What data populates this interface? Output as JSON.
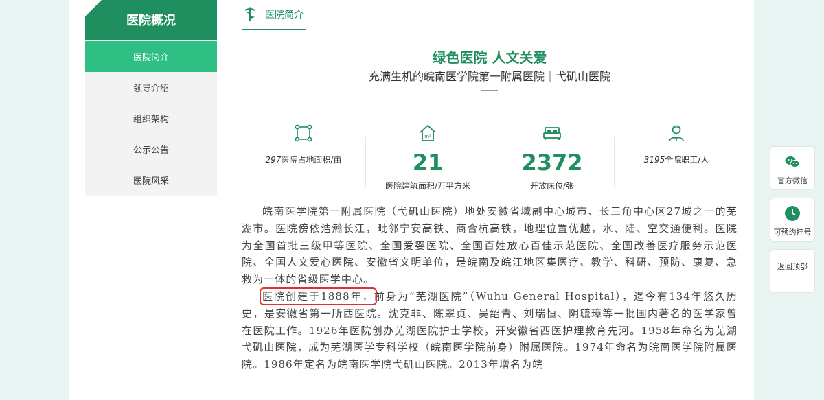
{
  "sidebar": {
    "title": "医院概况",
    "items": [
      {
        "label": "医院简介",
        "active": true
      },
      {
        "label": "领导介绍"
      },
      {
        "label": "组织架构"
      },
      {
        "label": "公示公告"
      },
      {
        "label": "医院风采"
      }
    ]
  },
  "section": {
    "title": "医院简介",
    "icon": "caduceus-icon"
  },
  "headline": {
    "title": "绿色医院 人文关爱",
    "subtitle": "充满生机的皖南医学院第一附属医院｜弋矶山医院"
  },
  "stats": [
    {
      "icon": "area-icon",
      "number": "297",
      "unit_label": "医院占地面积/亩"
    },
    {
      "icon": "building-icon",
      "number": "21",
      "unit_label": "医院建筑面积/万平方米"
    },
    {
      "icon": "bed-icon",
      "number": "2372",
      "unit_label": "开放床位/张"
    },
    {
      "icon": "doctor-icon",
      "number": "3195",
      "unit_label": "全院职工/人"
    }
  ],
  "body": {
    "p1": "皖南医学院第一附属医院（弋矶山医院）地处安徽省域副中心城市、长三角中心区27城之一的芜湖市。医院傍依浩瀚长江，毗邻宁安高铁、商合杭高铁，地理位置优越，水、陆、空交通便利。医院为全国首批三级甲等医院、全国爱婴医院、全国百姓放心百佳示范医院、全国改善医疗服务示范医院、全国人文爱心医院、安徽省文明单位，是皖南及皖江地区集医疗、教学、科研、预防、康复、急救为一体的省级医学中心。",
    "p2_highlight": "医院创建于1888年，",
    "p2_rest": "前身为“芜湖医院”（Wuhu General Hospital），迄今有134年悠久历史，是安徽省第一所西医院。沈克非、陈翠贞、吴绍青、刘瑞恒、阴毓璋等一批国内著名的医学家曾在医院工作。1926年医院创办芜湖医院护士学校，开安徽省西医护理教育先河。1958年命名为芜湖弋矶山医院，成为芜湖医学专科学校（皖南医学院前身）附属医院。1974年命名为皖南医学院附属医院。1986年定名为皖南医学院弋矶山医院。2013年增名为皖"
  },
  "tools": [
    {
      "label": "官方微信",
      "icon": "wechat-icon"
    },
    {
      "label": "可预约挂号",
      "icon": "clock-icon"
    },
    {
      "label": "返回顶部",
      "icon": ""
    }
  ],
  "colors": {
    "brand": "#1f8f5f",
    "active": "#2fbf84",
    "highlight": "#e03030"
  }
}
